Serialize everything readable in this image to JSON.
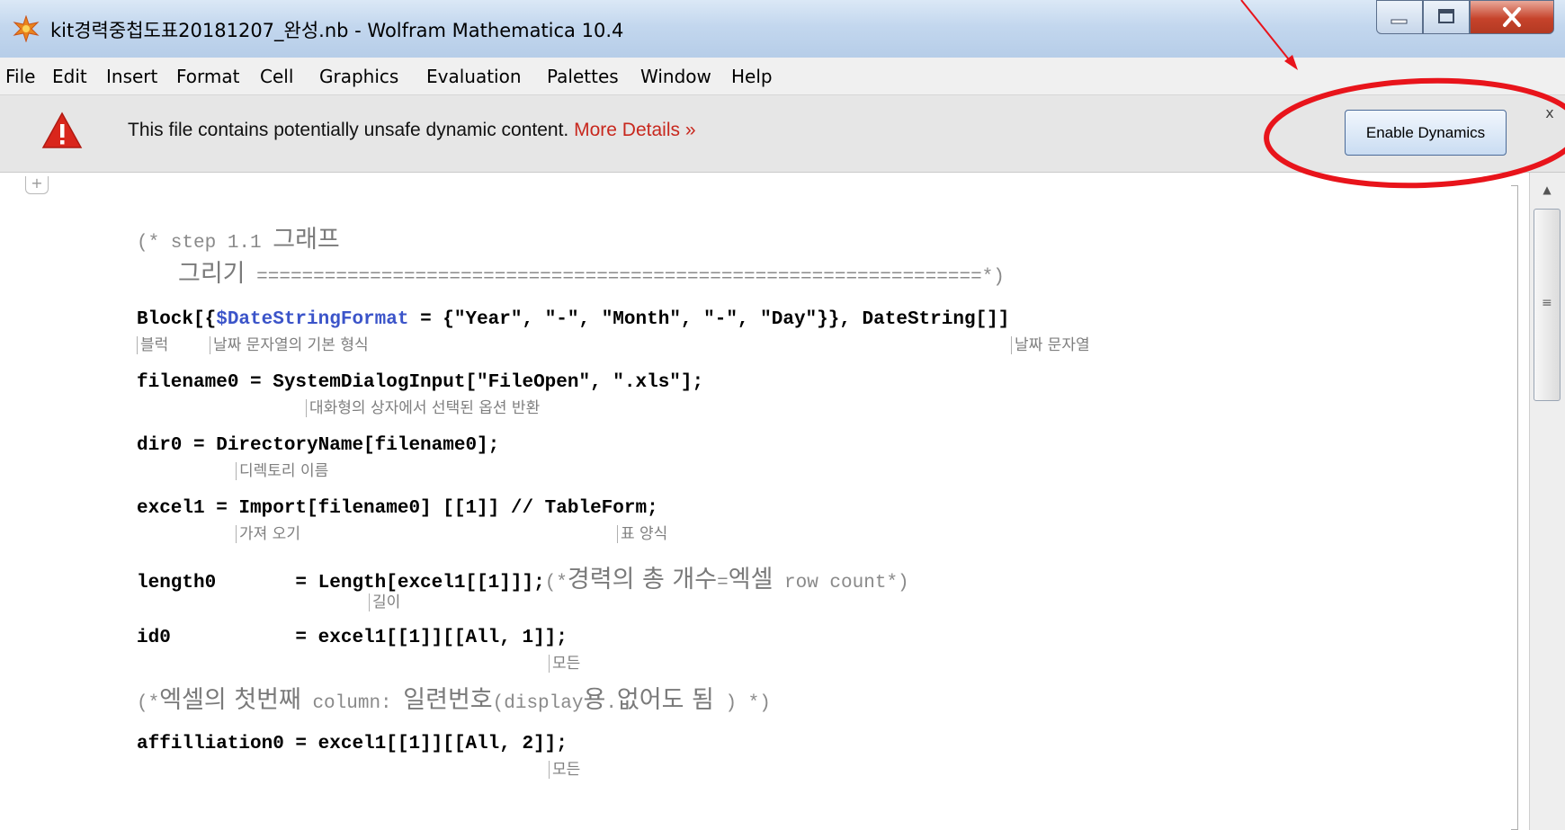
{
  "window": {
    "title": "kit경력중첩도표20181207_완성.nb - Wolfram Mathematica 10.4",
    "app_icon": "mathematica-star-icon",
    "controls": [
      "minimize-icon",
      "maximize-icon",
      "close-icon"
    ]
  },
  "menu": [
    "File",
    "Edit",
    "Insert",
    "Format",
    "Cell",
    "Graphics",
    "Evaluation",
    "Palettes",
    "Window",
    "Help"
  ],
  "banner": {
    "message": "This file contains potentially unsafe dynamic content.",
    "more_details": "More Details »",
    "button": "Enable Dynamics",
    "close": "x",
    "icon": "warning-triangle-icon"
  },
  "notebook": {
    "cell_insert": "+",
    "lines": {
      "c1a": "(* step 1.1 ",
      "c1b": "그래프",
      "c2a": "그리기",
      "c2b": " ================================================================*)",
      "block_kw": "Block[{",
      "block_var": "$DateStringFormat",
      "block_rest": " = {\"Year\", \"-\", \"Month\", \"-\", \"Day\"}}, DateString[]]",
      "fn": "filename0 = SystemDialogInput[\"FileOpen\", \".xls\"];",
      "dir": "dir0 = DirectoryName[filename0];",
      "excel": "excel1 = Import[filename0] [[1]] // TableForm;",
      "len": "length0       = Length[excel1[[1]]];",
      "len_cmt_a": "(*",
      "len_cmt_b": "경력의 총 개수",
      "len_cmt_c": "=",
      "len_cmt_d": "엑셀",
      "len_cmt_e": " row count*)",
      "id": "id0           = excel1[[1]][[All, 1]];",
      "c3a": "(*",
      "c3b": "엑셀의 첫번째",
      "c3c": " column: ",
      "c3d": "일련번호",
      "c3e": "(display",
      "c3f": "용",
      "c3g": ".",
      "c3h": "없어도 됨",
      "c3i": " ) *)",
      "aff": "affilliation0 = excel1[[1]][[All, 2]];"
    },
    "hints": {
      "block": "블럭",
      "dateformat": "날짜 문자열의 기본 형식",
      "datestring": "날짜 문자열",
      "dialog": "대화형의 상자에서 선택된 옵션 반환",
      "dirname": "디렉토리 이름",
      "import": "가져 오기",
      "tableform": "표 양식",
      "length": "길이",
      "all1": "모든",
      "all2": "모든"
    }
  },
  "colors": {
    "annotation": "#e8141b",
    "more_details": "#c8281e",
    "variable": "#3b54c9"
  }
}
